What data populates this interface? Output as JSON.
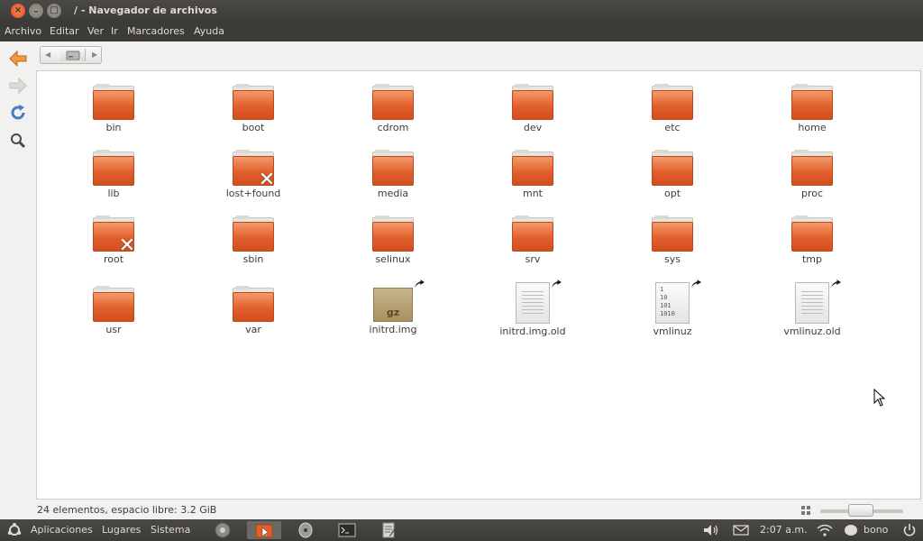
{
  "window": {
    "title": "/ - Navegador de archivos",
    "close": "×",
    "minimize": "⌄",
    "maximize": "□"
  },
  "menubar": [
    "Archivo",
    "Editar",
    "Ver",
    "Ir",
    "Marcadores",
    "Ayuda"
  ],
  "items": [
    {
      "name": "bin",
      "kind": "folder"
    },
    {
      "name": "boot",
      "kind": "folder"
    },
    {
      "name": "cdrom",
      "kind": "folder"
    },
    {
      "name": "dev",
      "kind": "folder"
    },
    {
      "name": "etc",
      "kind": "folder"
    },
    {
      "name": "home",
      "kind": "folder"
    },
    {
      "name": "lib",
      "kind": "folder"
    },
    {
      "name": "lost+found",
      "kind": "folder-locked"
    },
    {
      "name": "media",
      "kind": "folder"
    },
    {
      "name": "mnt",
      "kind": "folder"
    },
    {
      "name": "opt",
      "kind": "folder"
    },
    {
      "name": "proc",
      "kind": "folder"
    },
    {
      "name": "root",
      "kind": "folder-locked"
    },
    {
      "name": "sbin",
      "kind": "folder"
    },
    {
      "name": "selinux",
      "kind": "folder"
    },
    {
      "name": "srv",
      "kind": "folder"
    },
    {
      "name": "sys",
      "kind": "folder"
    },
    {
      "name": "tmp",
      "kind": "folder"
    },
    {
      "name": "usr",
      "kind": "folder"
    },
    {
      "name": "var",
      "kind": "folder"
    },
    {
      "name": "initrd.img",
      "kind": "archive-link"
    },
    {
      "name": "initrd.img.old",
      "kind": "text-link"
    },
    {
      "name": "vmlinuz",
      "kind": "binary-link"
    },
    {
      "name": "vmlinuz.old",
      "kind": "text-link"
    }
  ],
  "archive_label": "gz",
  "binary_lines": [
    "1",
    "10",
    "101",
    "1010"
  ],
  "status": {
    "text": "24 elementos, espacio libre: 3.2 GiB"
  },
  "panel": {
    "applications": "Aplicaciones",
    "places": "Lugares",
    "system": "Sistema",
    "clock": "2:07 a.m.",
    "user": "bono"
  },
  "colors": {
    "folder": "#e15f2c",
    "titlebar": "#3c3b37",
    "accent": "#dd4814"
  }
}
